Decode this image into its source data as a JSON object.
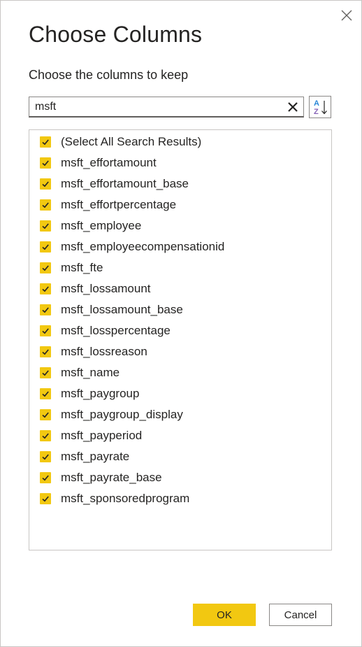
{
  "dialog": {
    "title": "Choose Columns",
    "subtitle": "Choose the columns to keep",
    "close_icon": "close-icon"
  },
  "search": {
    "value": "msft",
    "clear_icon": "clear-x-icon"
  },
  "sort": {
    "icon": "sort-az-icon",
    "letters": [
      "A",
      "Z"
    ]
  },
  "list": {
    "items": [
      {
        "label": "(Select All Search Results)",
        "checked": true
      },
      {
        "label": "msft_effortamount",
        "checked": true
      },
      {
        "label": "msft_effortamount_base",
        "checked": true
      },
      {
        "label": "msft_effortpercentage",
        "checked": true
      },
      {
        "label": "msft_employee",
        "checked": true
      },
      {
        "label": "msft_employeecompensationid",
        "checked": true
      },
      {
        "label": "msft_fte",
        "checked": true
      },
      {
        "label": "msft_lossamount",
        "checked": true
      },
      {
        "label": "msft_lossamount_base",
        "checked": true
      },
      {
        "label": "msft_losspercentage",
        "checked": true
      },
      {
        "label": "msft_lossreason",
        "checked": true
      },
      {
        "label": "msft_name",
        "checked": true
      },
      {
        "label": "msft_paygroup",
        "checked": true
      },
      {
        "label": "msft_paygroup_display",
        "checked": true
      },
      {
        "label": "msft_payperiod",
        "checked": true
      },
      {
        "label": "msft_payrate",
        "checked": true
      },
      {
        "label": "msft_payrate_base",
        "checked": true
      },
      {
        "label": "msft_sponsoredprogram",
        "checked": true
      }
    ]
  },
  "buttons": {
    "ok_label": "OK",
    "cancel_label": "Cancel"
  },
  "colors": {
    "accent": "#f2c811",
    "text": "#252423",
    "border": "#8a8886"
  }
}
